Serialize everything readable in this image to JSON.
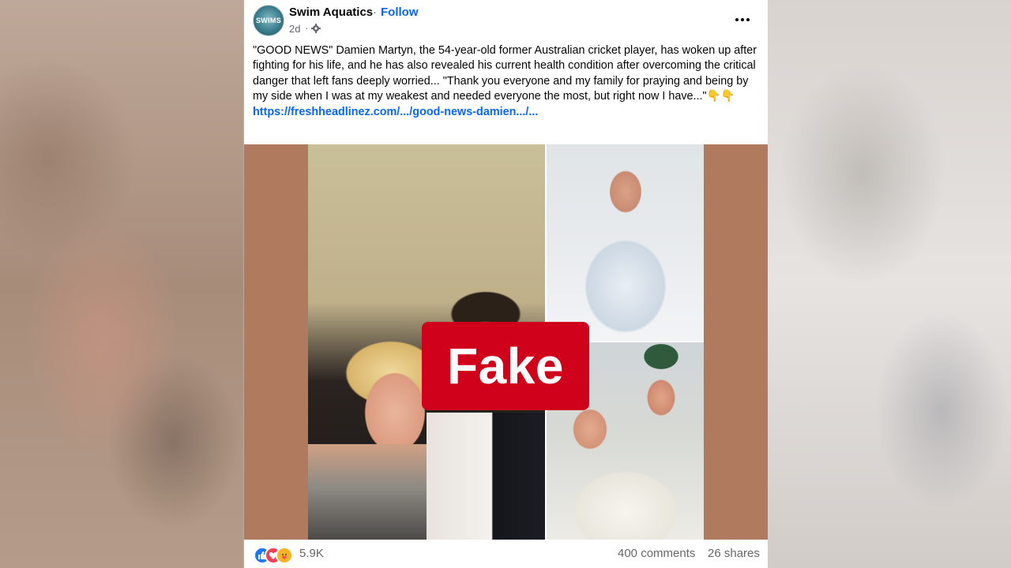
{
  "post": {
    "page_name": "Swim Aquatics",
    "avatar_text": "SWIMS",
    "separator": "·",
    "follow_label": "Follow",
    "time": "2d",
    "time_separator": "·",
    "text": "\"GOOD NEWS\" Damien Martyn, the 54-year-old former Australian cricket player, has woken up after fighting for his life, and he has also revealed his current health condition after overcoming the critical danger that left fans deeply worried... \"Thank you everyone and my family for praying and being by my side when I was at my weakest and needed everyone the most, but right now I have...\"👇👇",
    "link": "https://freshheadlinez.com/.../good-news-damien.../..."
  },
  "media": {
    "overlay_label": "Fake",
    "overlay_color": "#d0021b"
  },
  "footer": {
    "reaction_count": "5.9K",
    "comments": "400 comments",
    "shares": "26 shares"
  },
  "colors": {
    "accent": "#0866ff",
    "like": "#1877f2",
    "love": "#f33e58",
    "care": "#f7b125"
  }
}
